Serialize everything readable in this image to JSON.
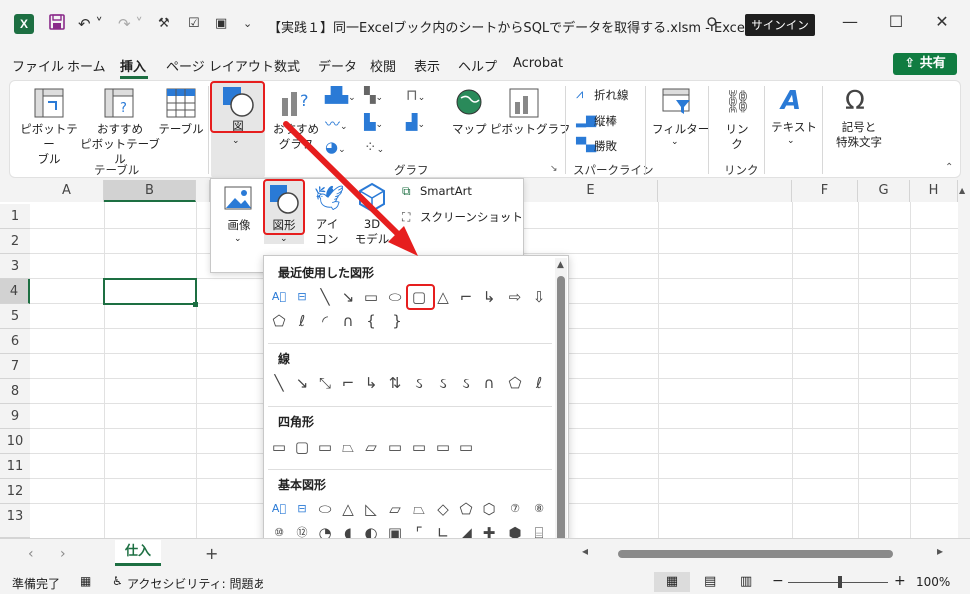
{
  "window": {
    "title": "【実践１】同一Excelブック内のシートからSQLでデータを取得する.xlsm  -  Excel",
    "signin_label": "サインイン",
    "logo_letter": "X"
  },
  "tabs": [
    "ファイル",
    "ホーム",
    "挿入",
    "ページ レイアウト",
    "数式",
    "データ",
    "校閲",
    "表示",
    "ヘルプ",
    "Acrobat"
  ],
  "active_tab": "挿入",
  "share_label": "共有",
  "ribbon": {
    "pivot_table": "ピボットテー\nブル",
    "recommended_pivot": "おすすめ\nピボットテーブル",
    "table": "テーブル",
    "illustrations": "図",
    "recommended_chart": "おすすめ\nグラフ",
    "map": "マップ",
    "pivot_chart": "ピボットグラフ",
    "spark_line": "折れ線",
    "spark_column": "縦棒",
    "spark_winloss": "勝敗",
    "filter": "フィルター",
    "link": "リン\nク",
    "text": "テキスト",
    "symbols": "記号と\n特殊文字",
    "group_table": "テーブル",
    "group_chart": "グラフ",
    "group_sparkline": "スパークライン",
    "group_link": "リンク"
  },
  "illus_menu": {
    "picture": "画像",
    "shapes": "図形",
    "icons": "アイ\nコン",
    "models3d": "3D\nモデル",
    "smartart": "SmartArt",
    "screenshot": "スクリーンショット"
  },
  "shapes_panel": {
    "recent": "最近使用した図形",
    "lines": "線",
    "rectangles": "四角形",
    "basic": "基本図形"
  },
  "columns": [
    "A",
    "B",
    "",
    "",
    "",
    "E",
    "",
    "F",
    "G",
    "H"
  ],
  "rows": [
    "1",
    "2",
    "3",
    "4",
    "5",
    "6",
    "7",
    "8",
    "9",
    "10",
    "11",
    "12",
    "13"
  ],
  "sheet_tab": "仕入",
  "add_sheet": "+",
  "status": {
    "ready": "準備完了",
    "accessibility": "アクセシビリティ: 問題ありませ",
    "zoom": "100%"
  }
}
